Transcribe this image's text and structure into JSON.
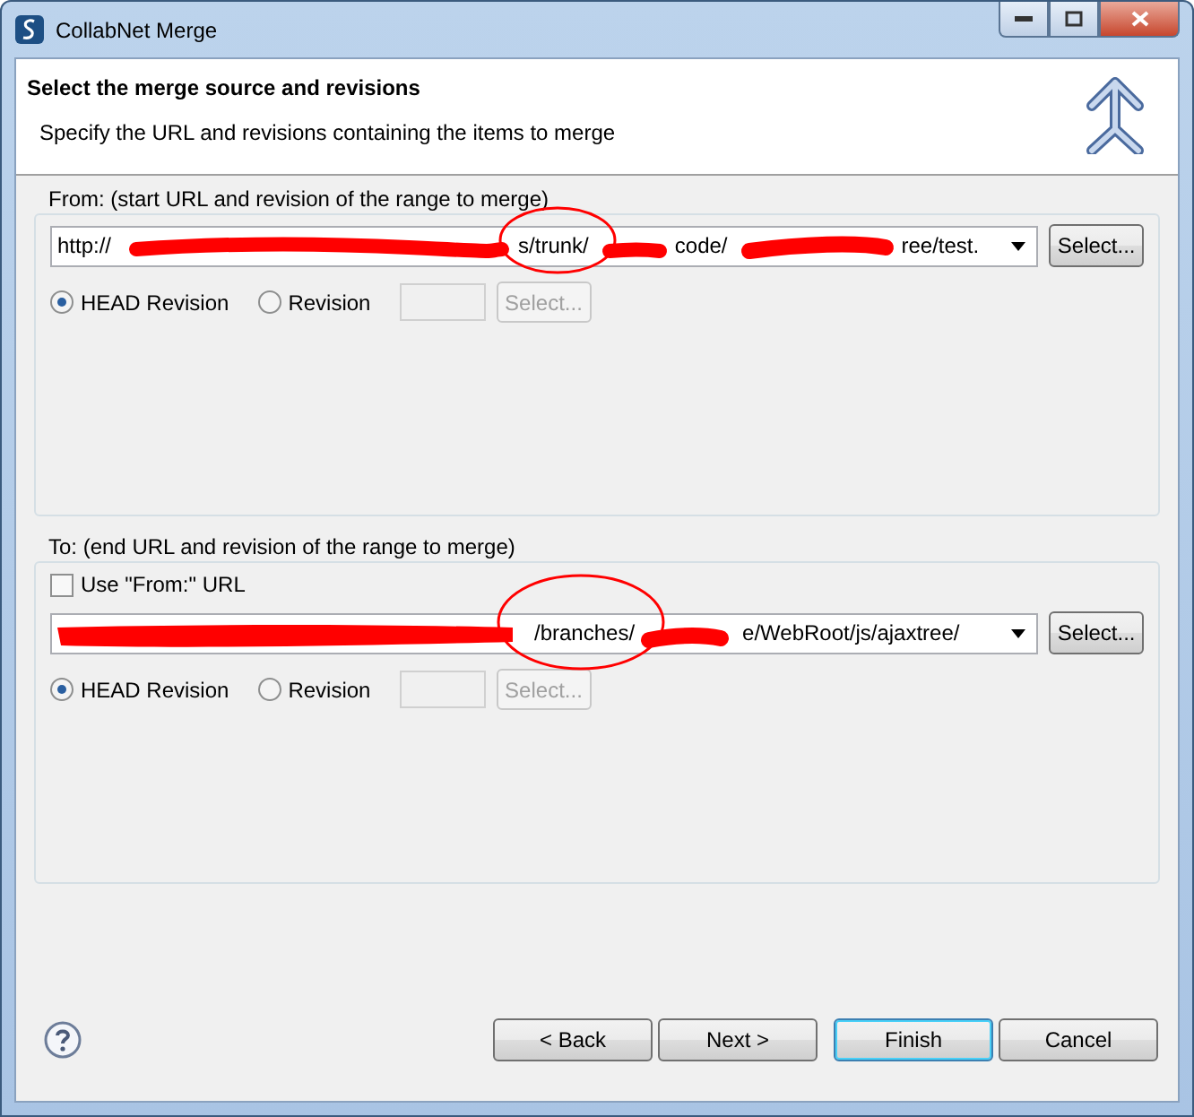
{
  "window": {
    "title": "CollabNet Merge"
  },
  "header": {
    "title": "Select the merge source and revisions",
    "subtitle": "Specify the URL and revisions containing the items to merge"
  },
  "sections": [
    {
      "label": "From: (start URL and revision of the range to merge)",
      "url_fragments": [
        "http://",
        "s/trunk/",
        "code/",
        "ree/test."
      ],
      "select_button": "Select...",
      "revision_options": [
        {
          "label": "HEAD Revision",
          "selected": true
        },
        {
          "label": "Revision",
          "selected": false
        }
      ],
      "revision_field": {
        "disabled": true
      },
      "revision_select": {
        "label": "Select...",
        "disabled": true
      }
    },
    {
      "label": "To: (end URL and revision of the range to merge)",
      "use_from": {
        "label": "Use \"From:\" URL",
        "checked": false
      },
      "url_fragments": [
        "/branches/",
        "e/WebRoot/js/ajaxtree/"
      ],
      "select_button": "Select...",
      "revision_options": [
        {
          "label": "HEAD Revision",
          "selected": true
        },
        {
          "label": "Revision",
          "selected": false
        }
      ],
      "revision_field": {
        "disabled": true
      },
      "revision_select": {
        "label": "Select...",
        "disabled": true
      }
    }
  ],
  "buttons": [
    {
      "label": "< Back",
      "default": false
    },
    {
      "label": "Next >",
      "default": false
    },
    {
      "label": "Finish",
      "default": true
    },
    {
      "label": "Cancel",
      "default": false
    }
  ]
}
